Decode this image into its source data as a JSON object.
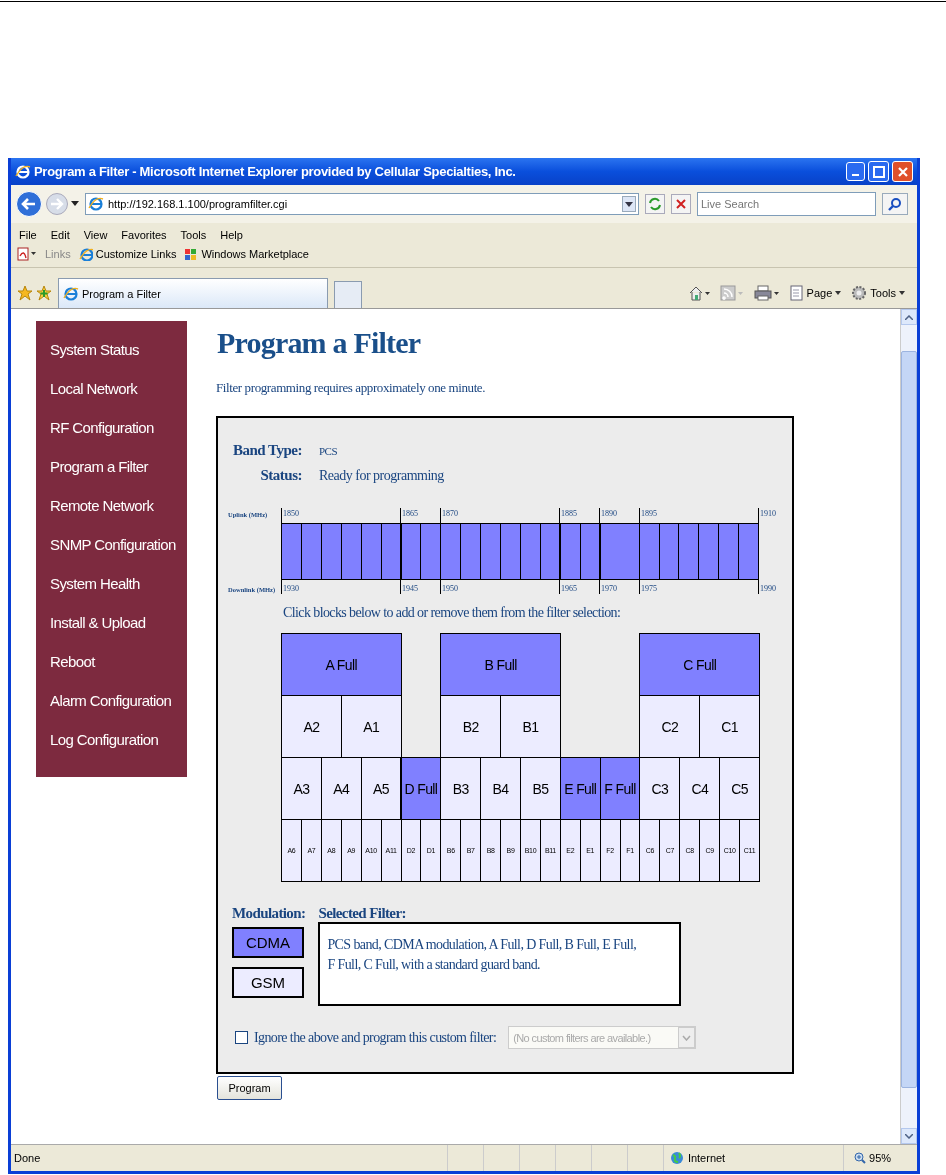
{
  "window": {
    "title": "Program a Filter - Microsoft Internet Explorer provided by Cellular Specialties, Inc."
  },
  "address_bar": {
    "url": "http://192.168.1.100/programfilter.cgi",
    "search_placeholder": "Live Search"
  },
  "menu": [
    "File",
    "Edit",
    "View",
    "Favorites",
    "Tools",
    "Help"
  ],
  "links_bar": {
    "label": "Links",
    "items": [
      "Customize Links",
      "Windows Marketplace"
    ]
  },
  "tabs": [
    {
      "label": "Program a Filter",
      "selected": true
    }
  ],
  "command_bar": [
    "Page",
    "Tools"
  ],
  "sidebar": {
    "items": [
      "System Status",
      "Local Network",
      "RF Configuration",
      "Program a Filter",
      "Remote Network",
      "SNMP Configuration",
      "System Health",
      "Install & Upload",
      "Reboot",
      "Alarm Configuration",
      "Log Configuration"
    ]
  },
  "page": {
    "heading": "Program a Filter",
    "note": "Filter programming requires approximately one minute.",
    "band_type": {
      "label": "Band Type:",
      "value": "PCS"
    },
    "status": {
      "label": "Status:",
      "value": "Ready for programming"
    },
    "spectrum": {
      "uplink_label": "Uplink (MHz)",
      "downlink_label": "Downlink (MHz)",
      "uplink_ticks": [
        "1850",
        "1865",
        "1870",
        "1885",
        "1890",
        "1895",
        "1910"
      ],
      "downlink_ticks": [
        "1930",
        "1945",
        "1950",
        "1965",
        "1970",
        "1975",
        "1990"
      ]
    },
    "instruction": "Click blocks below to add or remove them from the filter selection:",
    "sections": [
      {
        "tiers": [
          [
            {
              "label": "A Full",
              "selected": true
            }
          ],
          [
            {
              "label": "A2",
              "selected": false
            },
            {
              "label": "A1",
              "selected": false
            }
          ],
          [
            {
              "label": "A3",
              "selected": false
            },
            {
              "label": "A4",
              "selected": false
            },
            {
              "label": "A5",
              "selected": false
            }
          ],
          [
            {
              "label": "A6",
              "selected": false
            },
            {
              "label": "A7",
              "selected": false
            },
            {
              "label": "A8",
              "selected": false
            },
            {
              "label": "A9",
              "selected": false
            },
            {
              "label": "A10",
              "selected": false
            },
            {
              "label": "A11",
              "selected": false
            }
          ]
        ]
      },
      {
        "tiers": [
          [
            {
              "label": "D Full",
              "selected": true
            }
          ],
          [
            {
              "label": "D2",
              "selected": false
            },
            {
              "label": "D1",
              "selected": false
            }
          ]
        ]
      },
      {
        "tiers": [
          [
            {
              "label": "B Full",
              "selected": true
            }
          ],
          [
            {
              "label": "B2",
              "selected": false
            },
            {
              "label": "B1",
              "selected": false
            }
          ],
          [
            {
              "label": "B3",
              "selected": false
            },
            {
              "label": "B4",
              "selected": false
            },
            {
              "label": "B5",
              "selected": false
            }
          ],
          [
            {
              "label": "B6",
              "selected": false
            },
            {
              "label": "B7",
              "selected": false
            },
            {
              "label": "B8",
              "selected": false
            },
            {
              "label": "B9",
              "selected": false
            },
            {
              "label": "B10",
              "selected": false
            },
            {
              "label": "B11",
              "selected": false
            }
          ]
        ]
      },
      {
        "tiers": [
          [
            {
              "label": "E Full",
              "selected": true
            }
          ],
          [
            {
              "label": "E2",
              "selected": false
            },
            {
              "label": "E1",
              "selected": false
            }
          ]
        ]
      },
      {
        "tiers": [
          [
            {
              "label": "F Full",
              "selected": true
            }
          ],
          [
            {
              "label": "F2",
              "selected": false
            },
            {
              "label": "F1",
              "selected": false
            }
          ]
        ]
      },
      {
        "tiers": [
          [
            {
              "label": "C Full",
              "selected": true
            }
          ],
          [
            {
              "label": "C2",
              "selected": false
            },
            {
              "label": "C1",
              "selected": false
            }
          ],
          [
            {
              "label": "C3",
              "selected": false
            },
            {
              "label": "C4",
              "selected": false
            },
            {
              "label": "C5",
              "selected": false
            }
          ],
          [
            {
              "label": "C6",
              "selected": false
            },
            {
              "label": "C7",
              "selected": false
            },
            {
              "label": "C8",
              "selected": false
            },
            {
              "label": "C9",
              "selected": false
            },
            {
              "label": "C10",
              "selected": false
            },
            {
              "label": "C11",
              "selected": false
            }
          ]
        ]
      }
    ],
    "modulation": {
      "label": "Modulation:",
      "options": [
        {
          "label": "CDMA",
          "selected": true
        },
        {
          "label": "GSM",
          "selected": false
        }
      ]
    },
    "selected_filter": {
      "label": "Selected Filter:",
      "text": "PCS band, CDMA modulation, A Full, D Full, B Full, E Full, F Full, C Full, with a standard guard band."
    },
    "custom": {
      "checked": false,
      "label": "Ignore the above and program this custom filter:",
      "value": "(No custom filters are available.)",
      "disabled": true
    },
    "program_button": "Program"
  },
  "status_bar": {
    "text": "Done",
    "zone": "Internet",
    "zoom": "95%"
  }
}
